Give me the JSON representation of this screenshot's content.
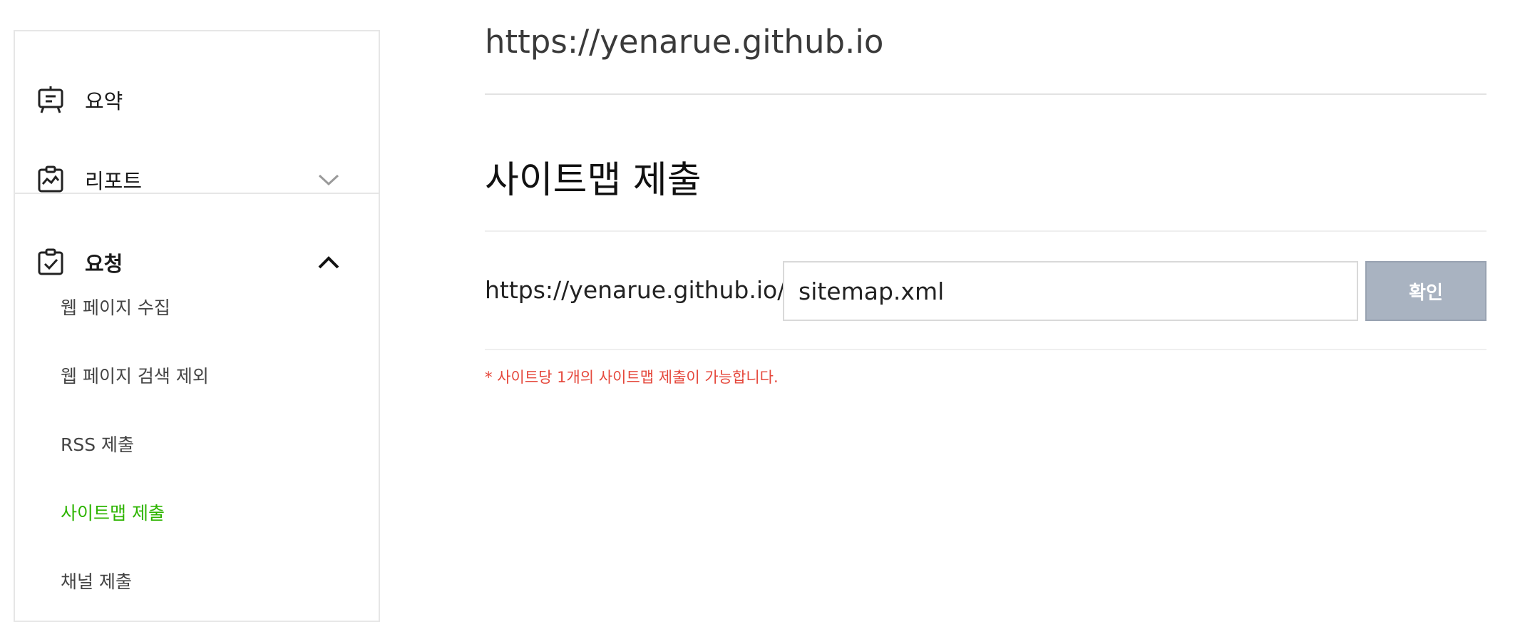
{
  "sidebar": {
    "summary_label": "요약",
    "reports_label": "리포트",
    "requests_label": "요청",
    "request_items": [
      {
        "label": "웹 페이지 수집"
      },
      {
        "label": "웹 페이지 검색 제외"
      },
      {
        "label": "RSS 제출"
      },
      {
        "label": "사이트맵 제출",
        "active": true
      },
      {
        "label": "채널 제출"
      }
    ]
  },
  "main": {
    "site_url": "https://yenarue.github.io",
    "section_title": "사이트맵 제출",
    "url_prefix": "https://yenarue.github.io/",
    "sitemap_value": "sitemap.xml",
    "confirm_label": "확인",
    "notice": "* 사이트당 1개의 사이트맵 제출이 가능합니다."
  },
  "colors": {
    "active": "#2db400",
    "notice": "#e5483c",
    "button_bg": "#a9b3c1"
  }
}
